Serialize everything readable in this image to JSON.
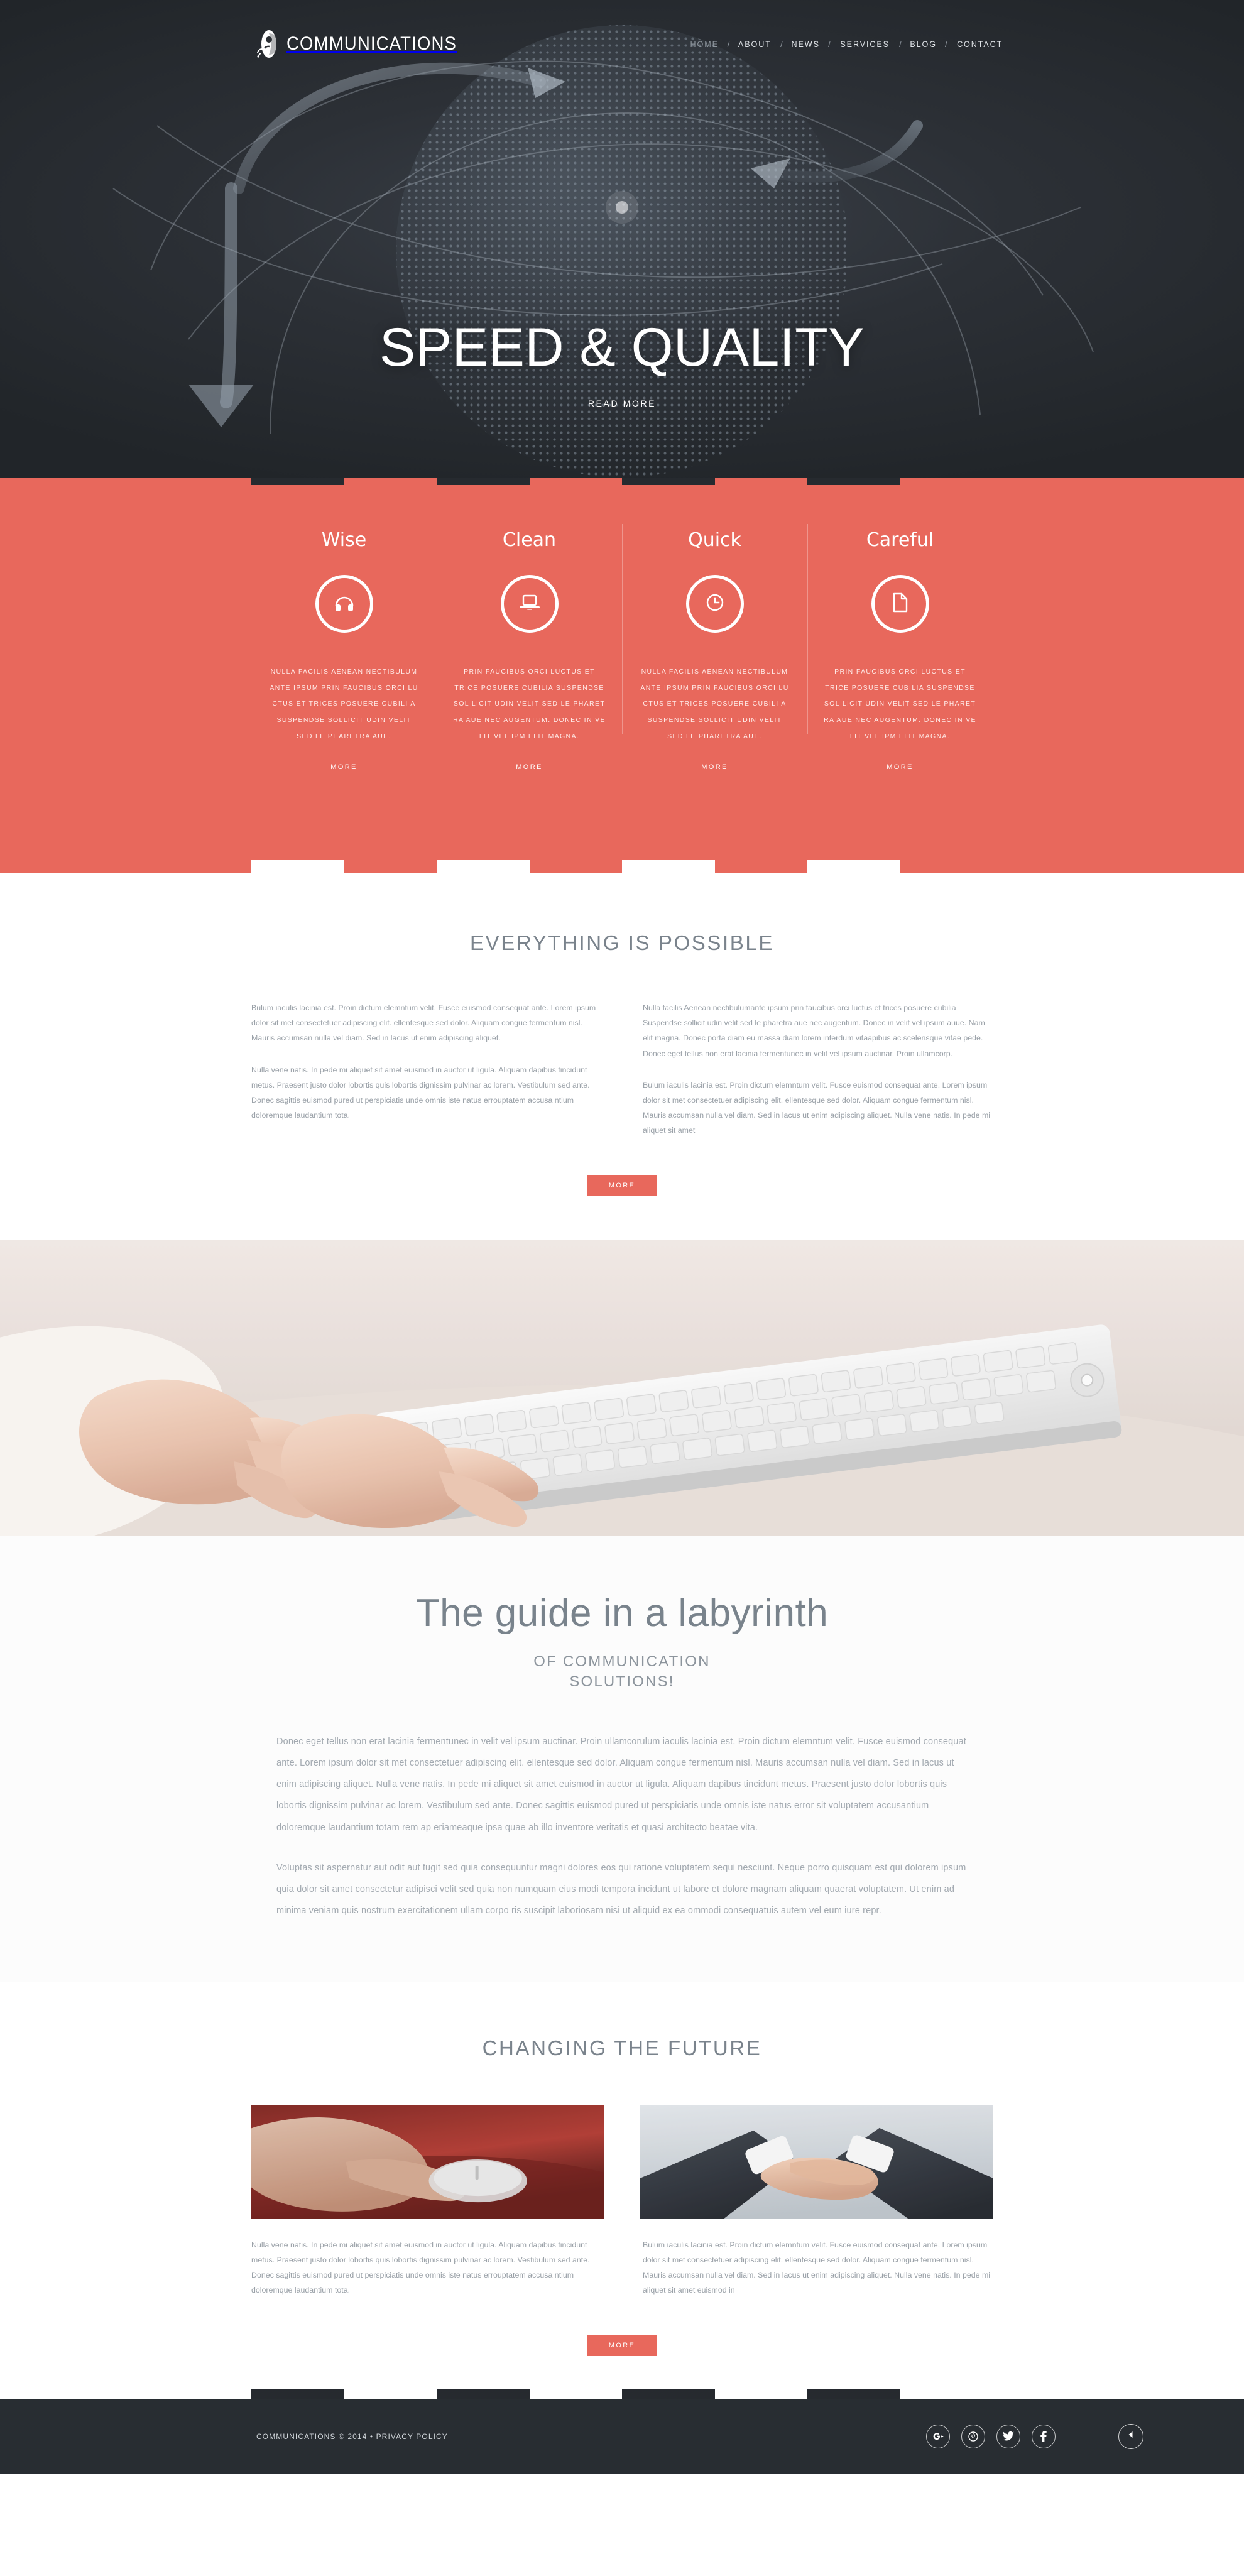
{
  "header": {
    "brand": "COMMUNICATIONS",
    "logo_icon": "globe-signal-icon",
    "nav": [
      {
        "label": "HOME",
        "active": true
      },
      {
        "label": "ABOUT",
        "active": false
      },
      {
        "label": "NEWS",
        "active": false
      },
      {
        "label": "SERVICES",
        "active": false
      },
      {
        "label": "BLOG",
        "active": false
      },
      {
        "label": "CONTACT",
        "active": false
      }
    ],
    "nav_separator": "/"
  },
  "hero": {
    "title": "SPEED & QUALITY",
    "cta": "READ MORE",
    "background_color": "#2b2f34",
    "globe_dot_color": "#96a3b0"
  },
  "features": {
    "accent_color": "#e8685c",
    "more_label": "MORE",
    "cards": [
      {
        "title": "Wise",
        "icon": "headphones-icon",
        "text": "NULLA FACILIS AENEAN NECTIBULUM ANTE IPSUM PRIN FAUCIBUS ORCI LU CTUS ET TRICES POSUERE CUBILI A SUSPENDSE SOLLICIT UDIN VELIT SED LE PHARETRA AUE."
      },
      {
        "title": "Clean",
        "icon": "laptop-icon",
        "text": "PRIN FAUCIBUS ORCI LUCTUS ET TRICE POSUERE CUBILIA SUSPENDSE SOL LICIT UDIN VELIT SED LE PHARET RA AUE NEC AUGENTUM. DONEC IN VE LIT VEL IPM ELIT MAGNA."
      },
      {
        "title": "Quick",
        "icon": "clock-icon",
        "text": "NULLA FACILIS AENEAN NECTIBULUM ANTE IPSUM PRIN FAUCIBUS ORCI LU CTUS ET TRICES POSUERE CUBILI A SUSPENDSE SOLLICIT UDIN VELIT SED LE PHARETRA AUE."
      },
      {
        "title": "Careful",
        "icon": "document-icon",
        "text": "PRIN FAUCIBUS ORCI LUCTUS ET TRICE POSUERE CUBILIA SUSPENDSE SOL LICIT UDIN VELIT SED LE PHARET RA AUE NEC AUGENTUM. DONEC IN VE LIT VEL IPM ELIT MAGNA."
      }
    ]
  },
  "possible": {
    "title": "EVERYTHING IS POSSIBLE",
    "left_p1": "Bulum iaculis lacinia est. Proin dictum elemntum velit. Fusce euismod consequat ante. Lorem ipsum dolor sit met consectetuer adipiscing elit. ellentesque sed dolor. Aliquam congue fermentum nisl. Mauris accumsan nulla vel diam. Sed in lacus ut enim adipiscing aliquet.",
    "left_p2": "Nulla vene natis. In pede mi aliquet sit amet euismod in auctor ut ligula. Aliquam dapibus tincidunt metus. Praesent justo dolor lobortis quis lobortis dignissim pulvinar ac lorem. Vestibulum sed ante. Donec sagittis euismod pured ut perspiciatis unde omnis iste natus errouptatem accusa ntium doloremque laudantium tota.",
    "right_p1": "Nulla facilis Aenean nectibulumante ipsum prin faucibus orci luctus et trices posuere cubilia Suspendse sollicit udin velit sed le pharetra aue nec augentum. Donec in velit vel ipsum auue. Nam elit magna. Donec porta diam eu massa diam lorem interdum vitaapibus ac scelerisque vitae pede. Donec eget tellus non erat lacinia fermentunec in velit vel ipsum auctinar. Proin ullamcorp.",
    "right_p2": "Bulum iaculis lacinia est. Proin dictum elemntum velit. Fusce euismod consequat ante. Lorem ipsum dolor sit met consectetuer adipiscing elit. ellentesque sed dolor. Aliquam congue fermentum nisl. Mauris accumsan nulla vel diam. Sed in lacus ut enim adipiscing aliquet. Nulla vene natis. In pede mi aliquet sit amet",
    "more_label": "MORE"
  },
  "photo_band": {
    "alt": "hands-typing-on-keyboard-photo"
  },
  "labyrinth": {
    "title": "The guide in a labyrinth",
    "subtitle_line1": "OF COMMUNICATION",
    "subtitle_line2": "SOLUTIONS!",
    "p1": "Donec eget tellus non erat lacinia fermentunec in velit vel ipsum auctinar. Proin ullamcorulum iaculis lacinia est. Proin dictum elemntum velit. Fusce euismod consequat ante. Lorem ipsum dolor sit met consectetuer adipiscing elit. ellentesque sed dolor. Aliquam congue fermentum nisl. Mauris accumsan nulla vel diam. Sed in lacus ut enim adipiscing aliquet. Nulla vene natis. In pede mi aliquet sit amet euismod in auctor ut ligula. Aliquam dapibus tincidunt metus. Praesent justo dolor lobortis quis lobortis dignissim pulvinar ac lorem. Vestibulum sed ante. Donec sagittis euismod pured ut perspiciatis unde omnis iste natus error sit voluptatem accusantium doloremque laudantium totam rem ap eriameaque ipsa quae ab illo inventore veritatis et quasi architecto beatae vita.",
    "p2": "Voluptas sit aspernatur aut odit aut fugit sed quia consequuntur magni dolores eos qui ratione voluptatem sequi nesciunt. Neque porro quisquam est qui dolorem ipsum quia dolor sit amet consectetur adipisci velit sed quia non numquam eius modi tempora incidunt ut labore et dolore magnam aliquam quaerat voluptatem. Ut enim ad minima veniam quis nostrum exercitationem ullam corpo ris suscipit laboriosam nisi ut aliquid ex ea ommodi consequatuis autem vel eum iure repr."
  },
  "future": {
    "title": "CHANGING THE FUTURE",
    "image_left_alt": "hand-on-computer-mouse-photo",
    "image_right_alt": "business-handshake-photo",
    "left_text": "Nulla vene natis. In pede mi aliquet sit amet euismod in auctor ut ligula. Aliquam dapibus tincidunt metus. Praesent justo dolor lobortis quis lobortis dignissim pulvinar ac lorem. Vestibulum sed ante. Donec sagittis euismod pured ut perspiciatis unde omnis iste natus errouptatem accusa ntium doloremque laudantium tota.",
    "right_text": "Bulum iaculis lacinia est. Proin dictum elemntum velit. Fusce euismod consequat ante. Lorem ipsum dolor sit met consectetuer adipiscing elit. ellentesque sed dolor. Aliquam congue fermentum nisl. Mauris accumsan nulla vel diam. Sed in lacus ut enim adipiscing aliquet. Nulla vene natis. In pede mi aliquet sit amet euismod in",
    "more_label": "MORE"
  },
  "footer": {
    "copyright": "COMMUNICATIONS © 2014 • PRIVACY POLICY",
    "background_color": "#282d32",
    "socials": [
      {
        "name": "google-plus-icon",
        "glyph": "g+"
      },
      {
        "name": "pinterest-icon",
        "glyph": "℗"
      },
      {
        "name": "twitter-icon",
        "glyph": "🐦"
      },
      {
        "name": "facebook-icon",
        "glyph": "f"
      }
    ],
    "back_to_top": "back-to-top-icon"
  }
}
